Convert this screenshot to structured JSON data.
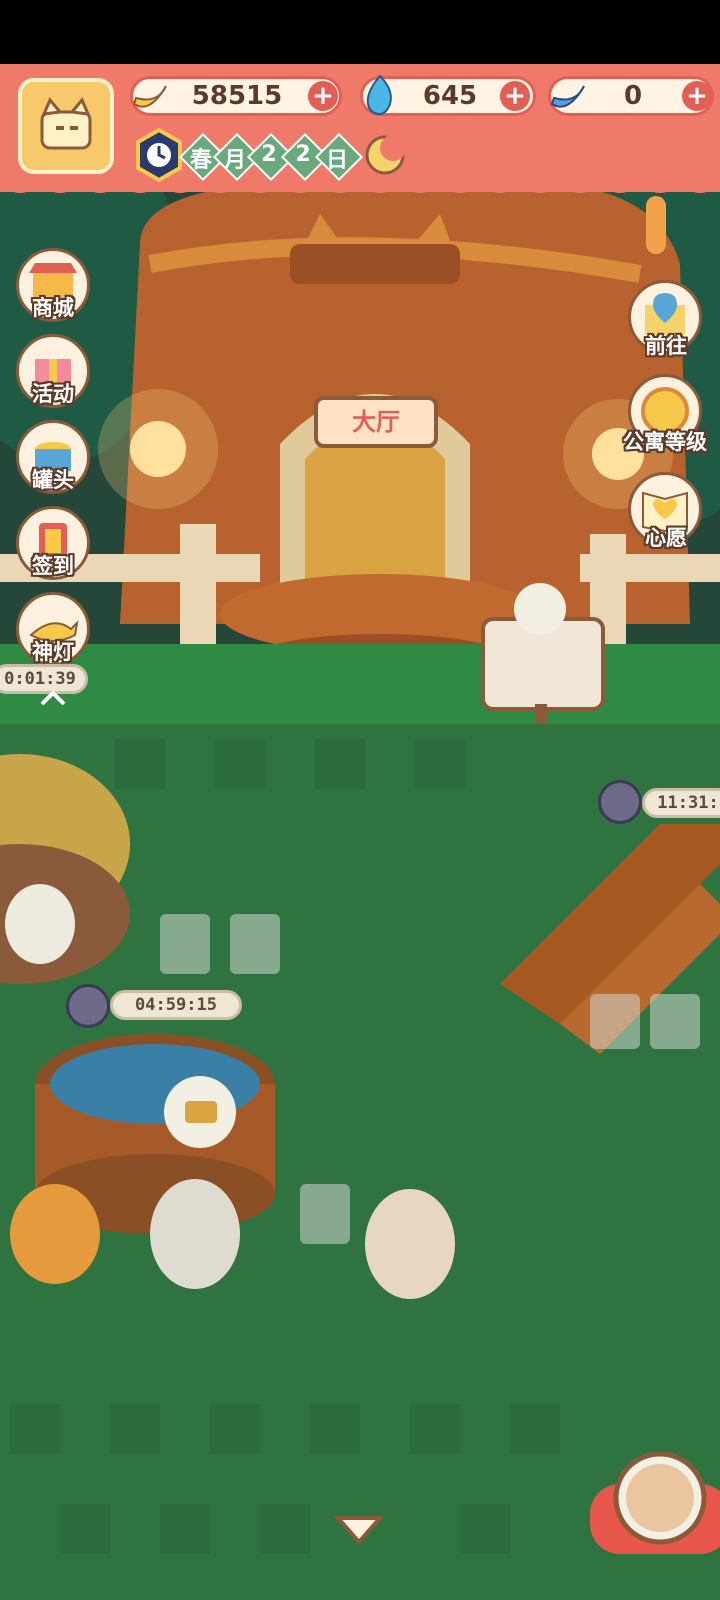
{
  "colors": {
    "header": "#f07a6a",
    "grass": "#2f6b3e",
    "accent": "#e25f55"
  },
  "currencies": [
    {
      "icon": "banana-icon",
      "value": "58515"
    },
    {
      "icon": "blue-flame-icon",
      "value": "645"
    },
    {
      "icon": "blue-banana-icon",
      "value": "0"
    }
  ],
  "date": {
    "chars": [
      "春",
      "月",
      "2",
      "2",
      "日"
    ]
  },
  "hall_sign": "大厅",
  "left_menu": [
    {
      "label": "商城",
      "icon": "shop-icon"
    },
    {
      "label": "活动",
      "icon": "gift-icon"
    },
    {
      "label": "罐头",
      "icon": "can-icon"
    },
    {
      "label": "签到",
      "icon": "checkin-icon"
    },
    {
      "label": "神灯",
      "icon": "magic-lamp-icon"
    }
  ],
  "right_menu": [
    {
      "label": "前往",
      "icon": "map-pin-icon"
    },
    {
      "label": "公寓等级",
      "icon": "sun-badge-icon"
    },
    {
      "label": "心愿",
      "icon": "wish-book-icon"
    }
  ],
  "timers": {
    "left_edge": "0:01:39",
    "right_edge": "11:31:",
    "pool": "04:59:15"
  }
}
